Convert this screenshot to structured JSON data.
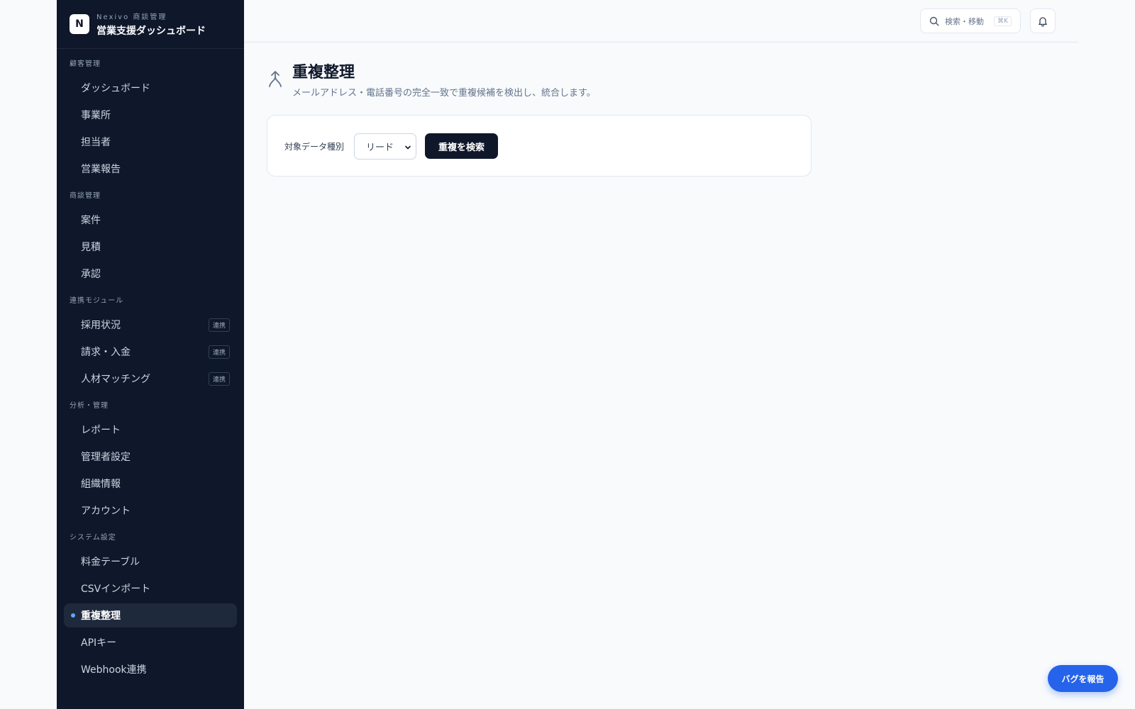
{
  "brand": {
    "logo_letter": "N",
    "subtitle": "Nexivo 商談管理",
    "title": "営業支援ダッシュボード"
  },
  "sidebar": {
    "sections": [
      {
        "label": "顧客管理",
        "items": [
          {
            "label": "ダッシュボード"
          },
          {
            "label": "事業所"
          },
          {
            "label": "担当者"
          },
          {
            "label": "営業報告"
          }
        ]
      },
      {
        "label": "商談管理",
        "items": [
          {
            "label": "案件"
          },
          {
            "label": "見積"
          },
          {
            "label": "承認"
          }
        ]
      },
      {
        "label": "連携モジュール",
        "items": [
          {
            "label": "採用状況",
            "badge": "連携"
          },
          {
            "label": "請求・入金",
            "badge": "連携"
          },
          {
            "label": "人材マッチング",
            "badge": "連携"
          }
        ]
      },
      {
        "label": "分析・管理",
        "items": [
          {
            "label": "レポート"
          },
          {
            "label": "管理者設定"
          },
          {
            "label": "組織情報"
          },
          {
            "label": "アカウント"
          }
        ]
      },
      {
        "label": "システム設定",
        "items": [
          {
            "label": "料金テーブル"
          },
          {
            "label": "CSVインポート"
          },
          {
            "label": "重複整理",
            "active": true
          },
          {
            "label": "APIキー"
          },
          {
            "label": "Webhook連携"
          }
        ]
      }
    ]
  },
  "topbar": {
    "search_label": "検索・移動",
    "search_shortcut": "⌘K"
  },
  "page": {
    "title": "重複整理",
    "description": "メールアドレス・電話番号の完全一致で重複候補を検出し、統合します。"
  },
  "form": {
    "field_label": "対象データ種別",
    "select_value": "リード",
    "submit_label": "重複を検索"
  },
  "bug_report_label": "バグを報告",
  "colors": {
    "sidebar_bg": "#0f172a",
    "accent": "#2563eb",
    "active_dot": "#60a5fa"
  }
}
